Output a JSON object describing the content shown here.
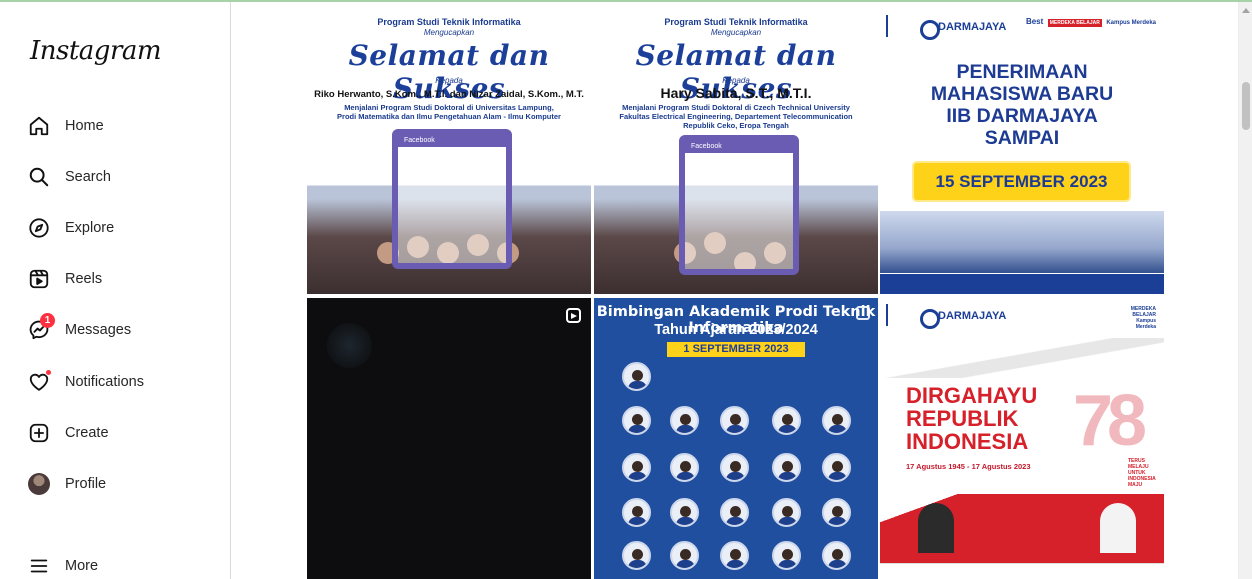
{
  "app": {
    "logo": "Instagram"
  },
  "sidebar": {
    "items": [
      {
        "label": "Home",
        "icon": "home-icon"
      },
      {
        "label": "Search",
        "icon": "search-icon"
      },
      {
        "label": "Explore",
        "icon": "compass-icon"
      },
      {
        "label": "Reels",
        "icon": "reels-icon"
      },
      {
        "label": "Messages",
        "icon": "messenger-icon",
        "badge": "1"
      },
      {
        "label": "Notifications",
        "icon": "heart-icon"
      },
      {
        "label": "Create",
        "icon": "plus-square-icon"
      },
      {
        "label": "Profile",
        "icon": "avatar"
      }
    ],
    "more": {
      "label": "More",
      "icon": "hamburger-icon"
    }
  },
  "posts": {
    "post1": {
      "program": "Program Studi Teknik Informatika",
      "mengucapkan": "Mengucapkan",
      "headline": "Selamat dan Sukses",
      "kepada": "Kepada",
      "person": "Riko Herwanto, S.Kom., M.T.I. dan Nizar Zaidal, S.Kom., M.T.",
      "desc1": "Menjalani Program Studi Doktoral di Universitas Lampung,",
      "desc2": "Prodi Matematika dan Ilmu Pengetahuan Alam - Ilmu Komputer",
      "frame_label": "Facebook"
    },
    "post2": {
      "program": "Program Studi Teknik Informatika",
      "mengucapkan": "Mengucapkan",
      "headline": "Selamat dan Sukses",
      "kepada": "Kepada",
      "person": "Hary Sabita, S.T., M.T.I.",
      "desc1": "Menjalani Program Studi Doktoral di Czech Technical University",
      "desc2": "Fakultas Electrical Engineering, Departement Telecommunication",
      "desc3": "Republik Ceko, Eropa Tengah",
      "frame_label": "Facebook"
    },
    "post3": {
      "brand": "DARMAJAYA",
      "badge1": "Best",
      "badge2": "MERDEKA BELAJAR",
      "badge3": "Kampus Merdeka",
      "line1": "PENERIMAAN",
      "line2": "MAHASISWA BARU",
      "line3": "IIB DARMAJAYA",
      "line4": "SAMPAI",
      "date": "15 SEPTEMBER 2023"
    },
    "post4": {
      "type": "reel"
    },
    "post5": {
      "title1": "Bimbingan Akademik Prodi Teknik Informatika",
      "title2": "Tahun Ajaran 2023/2024",
      "date": "1 SEPTEMBER 2023"
    },
    "post6": {
      "brand": "DARMAJAYA",
      "badge": "MERDEKA BELAJAR Kampus Merdeka",
      "line1": "DIRGAHAYU",
      "line2": "REPUBLIK",
      "line3": "INDONESIA",
      "number": "78",
      "side1": "TERUS",
      "side2": "MELAJU",
      "side3": "UNTUK",
      "side4": "INDONESIA",
      "side5": "MAJU",
      "dates": "17 Agustus 1945 - 17 Agustus 2023"
    }
  },
  "colors": {
    "brand_blue": "#1d3b93",
    "accent_red": "#d6202a",
    "badge_red": "#ff3040",
    "yellow": "#ffd21a"
  }
}
